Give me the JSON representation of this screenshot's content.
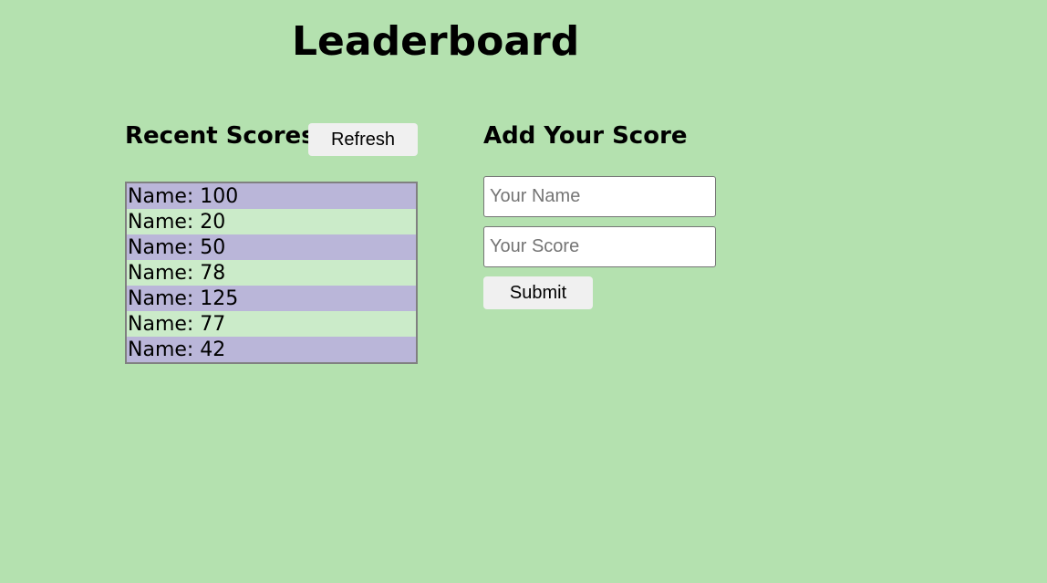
{
  "header": {
    "title": "Leaderboard"
  },
  "recent": {
    "title": "Recent Scores",
    "refresh_label": "Refresh",
    "scores": [
      "Name: 100",
      "Name: 20",
      "Name: 50",
      "Name: 78",
      "Name: 125",
      "Name: 77",
      "Name: 42"
    ]
  },
  "add": {
    "title": "Add Your Score",
    "name_placeholder": "Your Name",
    "name_value": "",
    "score_placeholder": "Your Score",
    "score_value": "",
    "submit_label": "Submit"
  },
  "colors": {
    "background": "#b4e1af",
    "row_odd": "#bab6d9",
    "row_even": "#cbebc9",
    "button": "#f0f0f0"
  }
}
